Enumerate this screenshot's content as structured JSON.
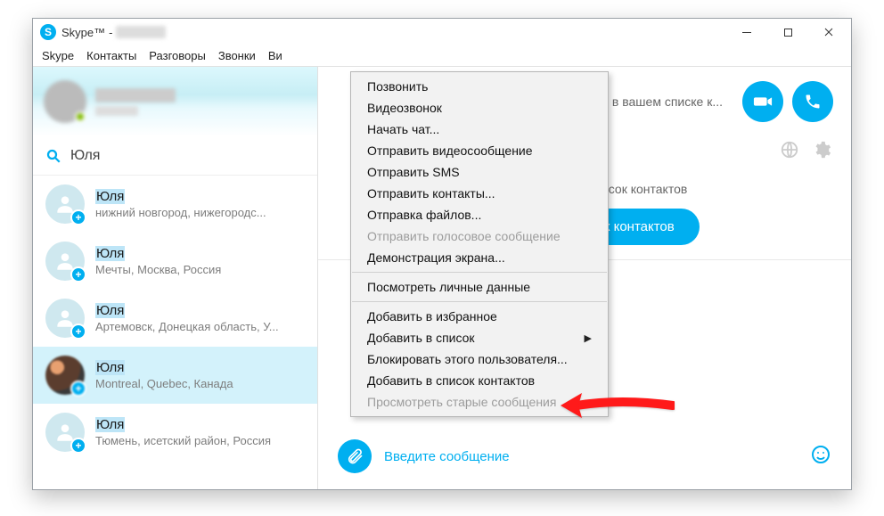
{
  "window": {
    "app_name": "Skype™",
    "title_sep": "-"
  },
  "menubar": {
    "skype": "Skype",
    "contacts": "Контакты",
    "conversations": "Разговоры",
    "calls": "Звонки",
    "view_partial": "Ви"
  },
  "search": {
    "query": "Юля"
  },
  "contacts": [
    {
      "name": "Юля",
      "location": "нижний новгород, нижегородс..."
    },
    {
      "name": "Юля",
      "location": "Мечты, Москва, Россия"
    },
    {
      "name": "Юля",
      "location": "Артемовск, Донецкая область, У..."
    },
    {
      "name": "Юля",
      "location": "Montreal, Quebec, Канада"
    },
    {
      "name": "Юля",
      "location": "Тюмень, исетский район, Россия"
    }
  ],
  "conversation": {
    "header_hint": "в вашем списке к...",
    "status": "не включен в ваш список контактов",
    "add_button": "Добавить в список контактов",
    "compose_placeholder": "Введите сообщение"
  },
  "context_menu": {
    "call": "Позвонить",
    "video_call": "Видеозвонок",
    "start_chat": "Начать чат...",
    "send_video_msg": "Отправить видеосообщение",
    "send_sms": "Отправить SMS",
    "send_contacts": "Отправить контакты...",
    "send_files": "Отправка файлов...",
    "send_voice_msg": "Отправить голосовое сообщение",
    "screen_share": "Демонстрация экрана...",
    "view_profile": "Посмотреть личные данные",
    "add_favorite": "Добавить в избранное",
    "add_to_list": "Добавить в список",
    "block_user": "Блокировать этого пользователя...",
    "add_to_contacts": "Добавить в список контактов",
    "view_old_msgs": "Просмотреть старые сообщения"
  }
}
